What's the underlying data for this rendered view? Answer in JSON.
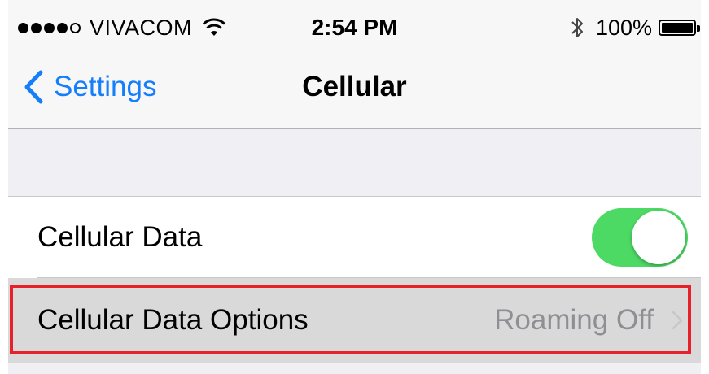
{
  "status_bar": {
    "carrier": "VIVACOM",
    "time": "2:54 PM",
    "battery_percent": "100%",
    "battery_level": 1.0,
    "signal_bars": 4,
    "icons": [
      "signal-dots-icon",
      "wifi-icon",
      "bluetooth-icon",
      "battery-icon"
    ]
  },
  "nav_bar": {
    "back_label": "Settings",
    "title": "Cellular"
  },
  "cells": {
    "cellular_data": {
      "label": "Cellular Data",
      "toggle_on": true
    },
    "cellular_data_options": {
      "label": "Cellular Data Options",
      "value": "Roaming Off"
    }
  },
  "colors": {
    "ios_blue": "#157efb",
    "toggle_green": "#4cd964",
    "highlight_red": "#e8202a",
    "detail_gray": "#8e8e93"
  }
}
